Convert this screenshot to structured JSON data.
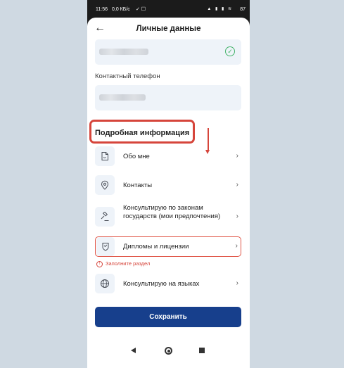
{
  "status_bar": {
    "time": "11:56",
    "network_speed": "0,0 КБ/с",
    "battery": "87"
  },
  "header": {
    "title": "Личные данные"
  },
  "fields": {
    "phone_label": "Контактный телефон"
  },
  "section": {
    "title": "Подробная информация"
  },
  "items": [
    {
      "label": "Обо мне",
      "icon": "document-icon"
    },
    {
      "label": "Контакты",
      "icon": "location-pin-icon"
    },
    {
      "label": "Консультирую по законам государств (мои предпочтения)",
      "icon": "gavel-icon"
    },
    {
      "label": "Дипломы и лицензии",
      "icon": "certificate-icon"
    },
    {
      "label": "Консультирую на языках",
      "icon": "globe-icon"
    }
  ],
  "error": {
    "message": "Заполните раздел"
  },
  "actions": {
    "save_label": "Сохранить"
  },
  "colors": {
    "primary": "#173f8c",
    "error": "#d6453b",
    "success": "#44b36a"
  }
}
